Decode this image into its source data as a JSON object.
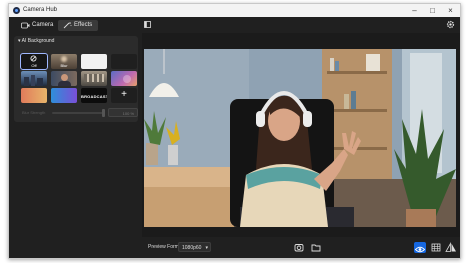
{
  "window": {
    "title": "Camera Hub",
    "controls": [
      "minimize-icon",
      "maximize-icon",
      "close-icon"
    ]
  },
  "tabs": [
    {
      "label": "Camera",
      "icon": "camera-icon",
      "active": false
    },
    {
      "label": "Effects",
      "icon": "magic-wand-icon",
      "active": true
    }
  ],
  "effects_panel": {
    "section_title": "AI Background",
    "tiles": [
      {
        "label": "Off",
        "icon": "off-icon"
      },
      {
        "label": "Blur",
        "icon": "blur-icon"
      },
      {
        "label": "",
        "icon": "white-background"
      },
      {
        "label": "",
        "icon": "dark-background"
      },
      {
        "label": "",
        "icon": "cityscape-image"
      },
      {
        "label": "",
        "icon": "portrait-image"
      },
      {
        "label": "",
        "icon": "studio-image"
      },
      {
        "label": "",
        "icon": "abstract-image"
      },
      {
        "label": "",
        "icon": "gradient-image"
      },
      {
        "label": "",
        "icon": "gradient-image-2"
      },
      {
        "label": "BROADCAST",
        "icon": "broadcast-logo"
      },
      {
        "label": "",
        "icon": "plus-icon"
      }
    ],
    "blur_slider": {
      "label": "Blur Strength",
      "value": "100 %",
      "enabled": false
    }
  },
  "bottom_bar": {
    "preview_format_label": "Preview Format",
    "preview_format_value": "1080p60",
    "icons": [
      "snapshot-icon",
      "folder-icon",
      "eye-icon",
      "grid-icon",
      "flip-icon"
    ]
  },
  "colors": {
    "accent": "#1667e0",
    "background": "#1b1b1b",
    "panel": "#202020"
  }
}
